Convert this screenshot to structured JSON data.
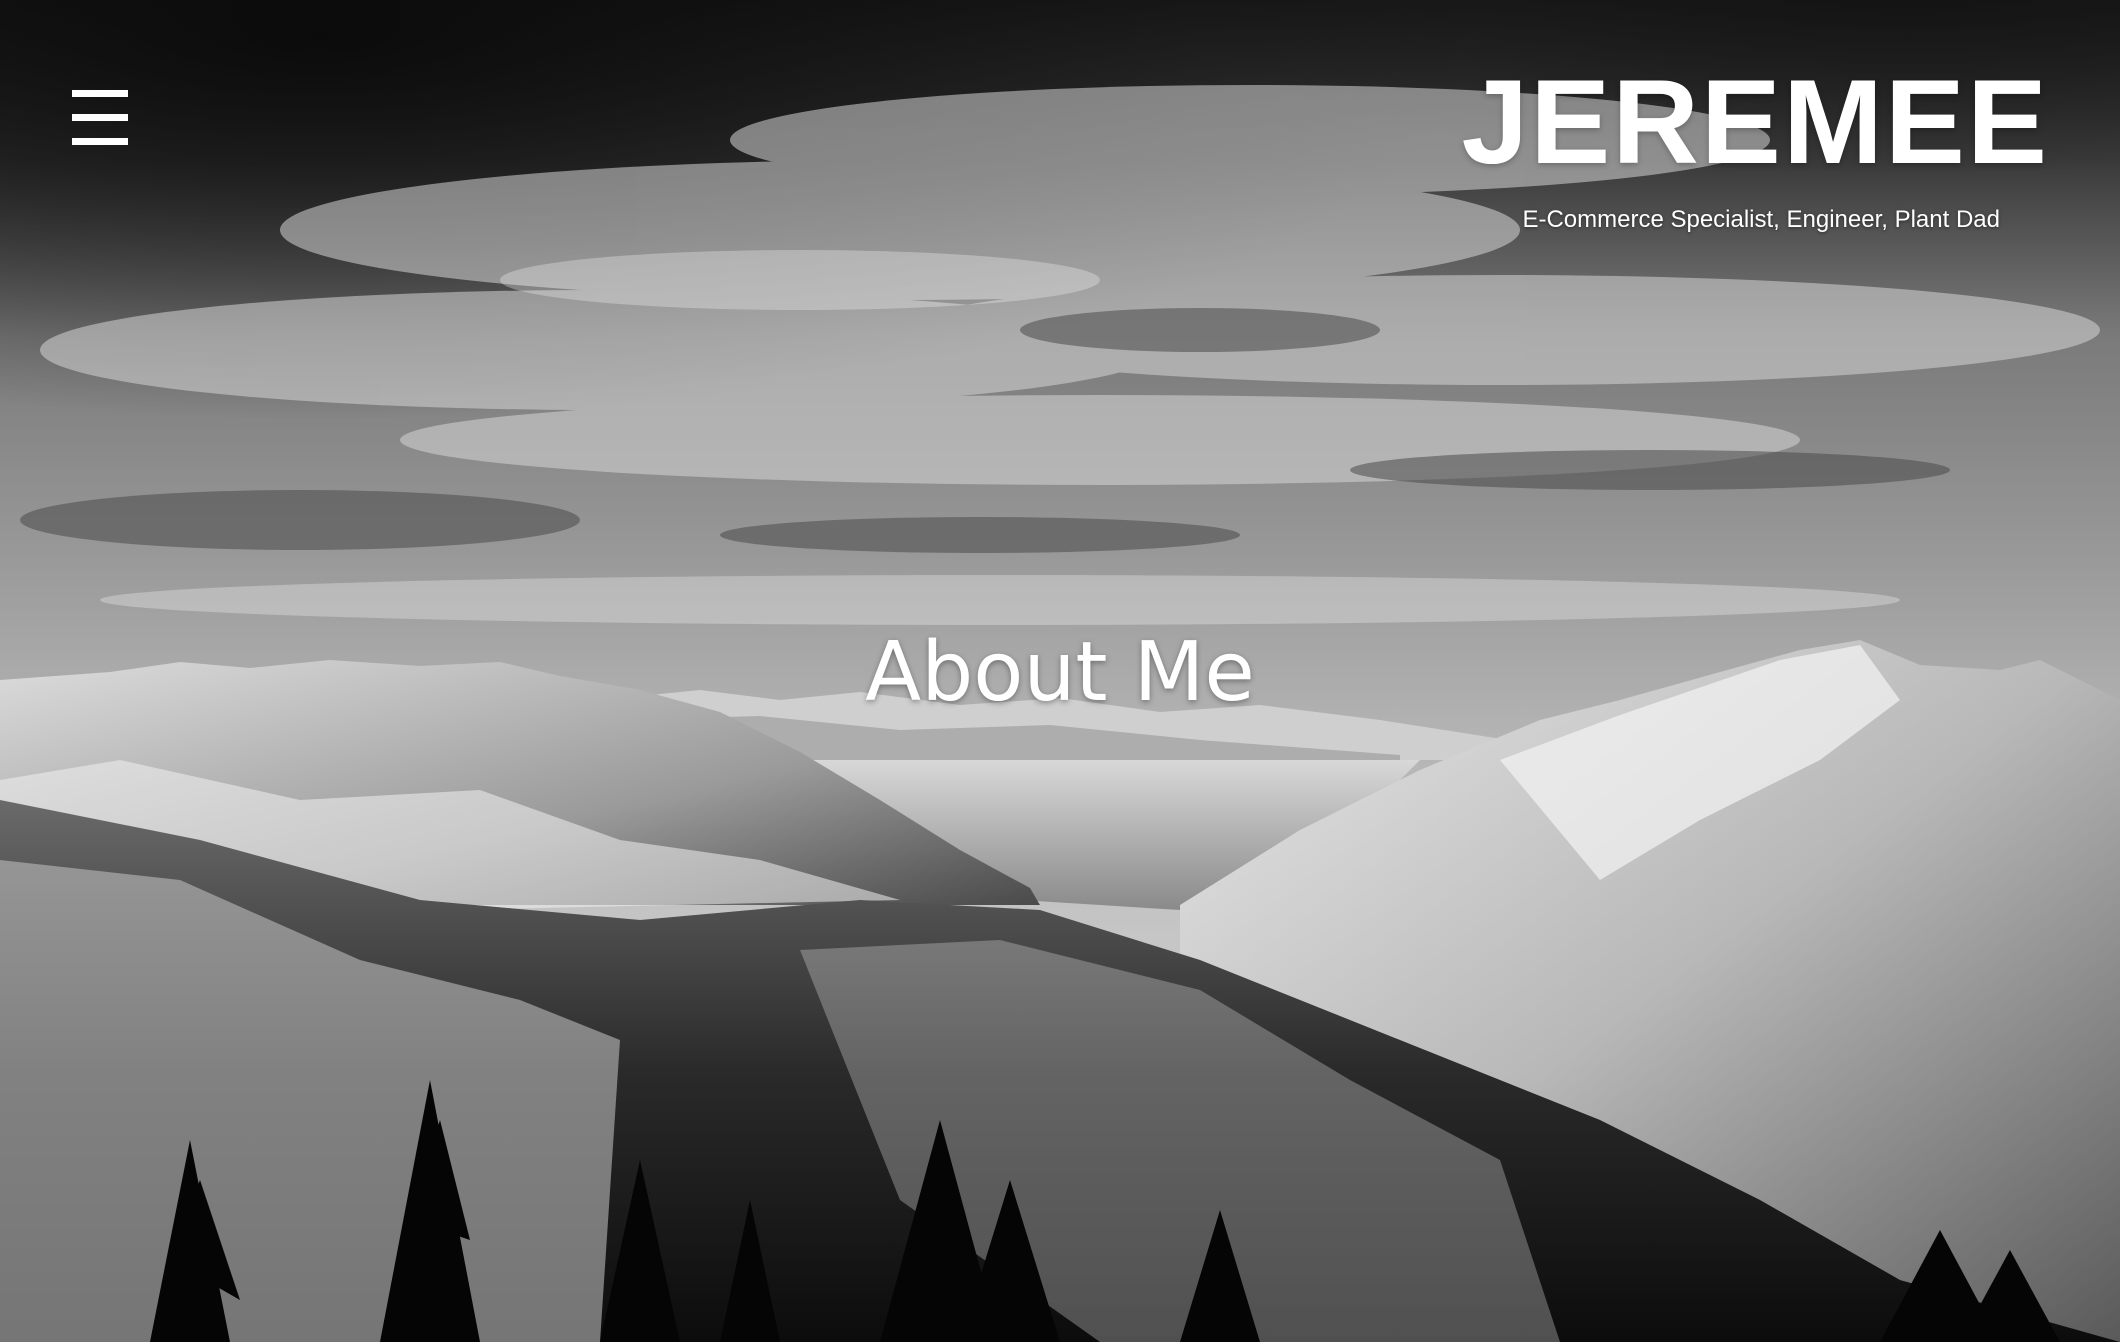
{
  "header": {
    "menu_icon": "hamburger-menu-icon",
    "brand_title": "JEREMEE",
    "brand_subtitle": "E-Commerce Specialist, Engineer, Plant Dad"
  },
  "hero": {
    "title": "About Me"
  }
}
